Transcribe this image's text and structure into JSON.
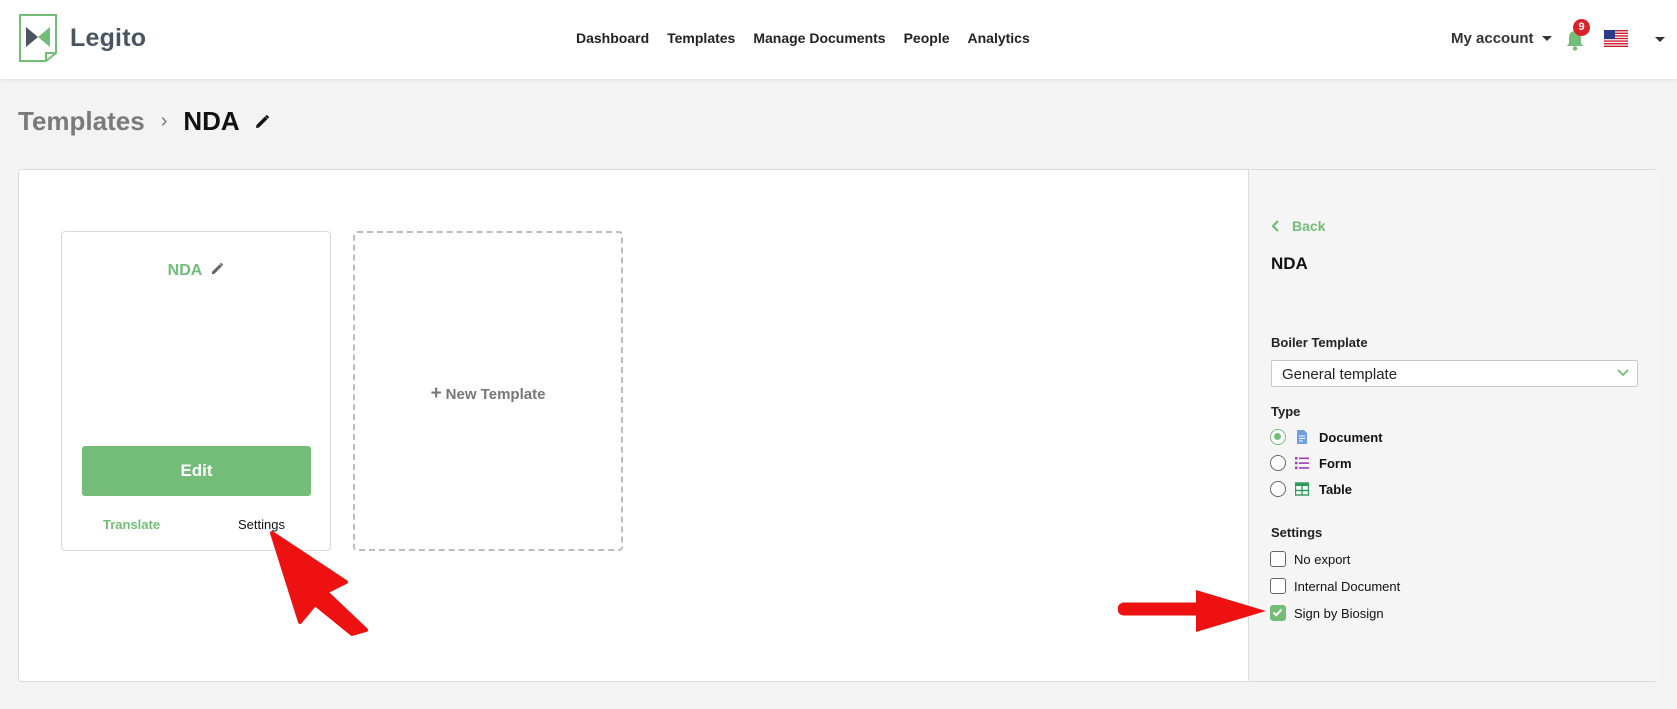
{
  "header": {
    "app_name": "Legito",
    "nav": [
      "Dashboard",
      "Templates",
      "Manage Documents",
      "People",
      "Analytics"
    ],
    "account_label": "My account",
    "notification_count": "9",
    "brand_color": "#73bd78",
    "badge_color": "#d9222a"
  },
  "breadcrumb": {
    "root": "Templates",
    "separator": "›",
    "current": "NDA"
  },
  "card": {
    "title": "NDA",
    "edit_label": "Edit",
    "translate_label": "Translate",
    "settings_label": "Settings"
  },
  "new_template": {
    "plus": "+",
    "label": "New Template"
  },
  "side_panel": {
    "back_label": "Back",
    "title": "NDA",
    "boiler_label": "Boiler Template",
    "boiler_value": "General template",
    "type_label": "Type",
    "types": [
      {
        "label": "Document",
        "icon": "document-icon",
        "selected": true
      },
      {
        "label": "Form",
        "icon": "list-icon",
        "selected": false
      },
      {
        "label": "Table",
        "icon": "table-icon",
        "selected": false
      }
    ],
    "settings_label": "Settings",
    "settings": [
      {
        "label": "No export",
        "checked": false
      },
      {
        "label": "Internal Document",
        "checked": false
      },
      {
        "label": "Sign by Biosign",
        "checked": true
      }
    ]
  }
}
